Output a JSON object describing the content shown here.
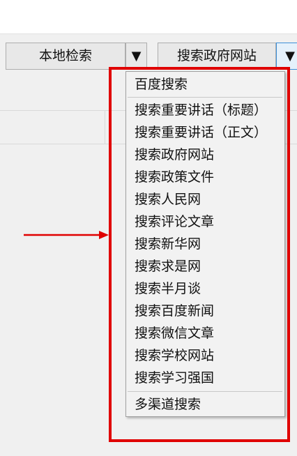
{
  "toolbar": {
    "local_search_label": "本地检索",
    "local_search_arrow": "▼",
    "gov_search_label": "搜索政府网站",
    "gov_search_arrow": "▼"
  },
  "menu": {
    "items": [
      "百度搜索",
      "搜索重要讲话（标题）",
      "搜索重要讲话（正文）",
      "搜索政府网站",
      "搜索政策文件",
      "搜索人民网",
      "搜索评论文章",
      "搜索新华网",
      "搜索求是网",
      "搜索半月谈",
      "搜索百度新闻",
      "搜索微信文章",
      "搜索学校网站",
      "搜索学习强国",
      "多渠道搜索"
    ]
  },
  "colors": {
    "highlight_box": "#e00000",
    "arrow": "#e00000",
    "dropdown_active_border": "#3c8ed8"
  }
}
